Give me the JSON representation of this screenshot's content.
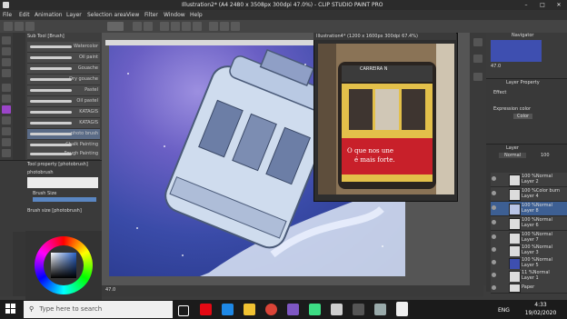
{
  "window": {
    "title": "Illustration2* (A4 2480 x 3508px 300dpi 47.0%) - CLIP STUDIO PAINT PRO",
    "min": "–",
    "max": "□",
    "close": "✕"
  },
  "menu": [
    "File",
    "Edit",
    "Animation",
    "Layer",
    "Selection area",
    "View",
    "Filter",
    "Window",
    "Help"
  ],
  "brush_panel": {
    "header": "Sub Tool [Brush]",
    "brushes": [
      "Watercolor",
      "Oil paint",
      "Gouache",
      "Dry gouache",
      "Pastel",
      "Oil pastel",
      "KATAGIS",
      "KATAGIS",
      "photo brush",
      "Chalk Painting",
      "Rough Painting"
    ]
  },
  "tool_property": {
    "header": "Tool property [photobrush]",
    "name": "photobrush",
    "brush_size_label": "Brush Size"
  },
  "brush_size_panel": {
    "header": "Brush size [photobrush]"
  },
  "reference_window": {
    "title": "Illustration4* (1200 x 1600px 300dpi 67.4%)"
  },
  "reference_image": {
    "tram_sign": "CARREIRA N",
    "tram_number": "28",
    "ad_text_line1": "O que nos une",
    "ad_text_line2": "é mais forte."
  },
  "navigator": {
    "header": "Navigator",
    "zoom": "47.0"
  },
  "layer_property": {
    "header": "Layer Property",
    "effect_label": "Effect",
    "expression_color_label": "Expression color",
    "expression_color_value": "Color"
  },
  "layer_panel": {
    "header": "Layer",
    "blend": "Normal",
    "opacity": "100",
    "layers": [
      {
        "opacity": "100 %Normal",
        "name": "Layer 2"
      },
      {
        "opacity": "100 %Color burn",
        "name": "Layer 4"
      },
      {
        "opacity": "100 %Normal",
        "name": "Layer 8"
      },
      {
        "opacity": "100 %Normal",
        "name": "Layer 6"
      },
      {
        "opacity": "100 %Normal",
        "name": "Layer 7"
      },
      {
        "opacity": "100 %Normal",
        "name": "Layer 3"
      },
      {
        "opacity": "100 %Normal",
        "name": "Layer 5"
      },
      {
        "opacity": "11 %Normal",
        "name": "Layer 1"
      },
      {
        "opacity": "",
        "name": "Paper"
      }
    ]
  },
  "canvas_status": {
    "zoom": "47.0"
  },
  "taskbar": {
    "search_placeholder": "Type here to search",
    "tray_lang": "ENG",
    "time": "4:33",
    "date": "19/02/2020"
  },
  "colors": {
    "accent": "#3d5f93",
    "tram_yellow": "#e8c33a",
    "tram_red": "#c8202a"
  }
}
